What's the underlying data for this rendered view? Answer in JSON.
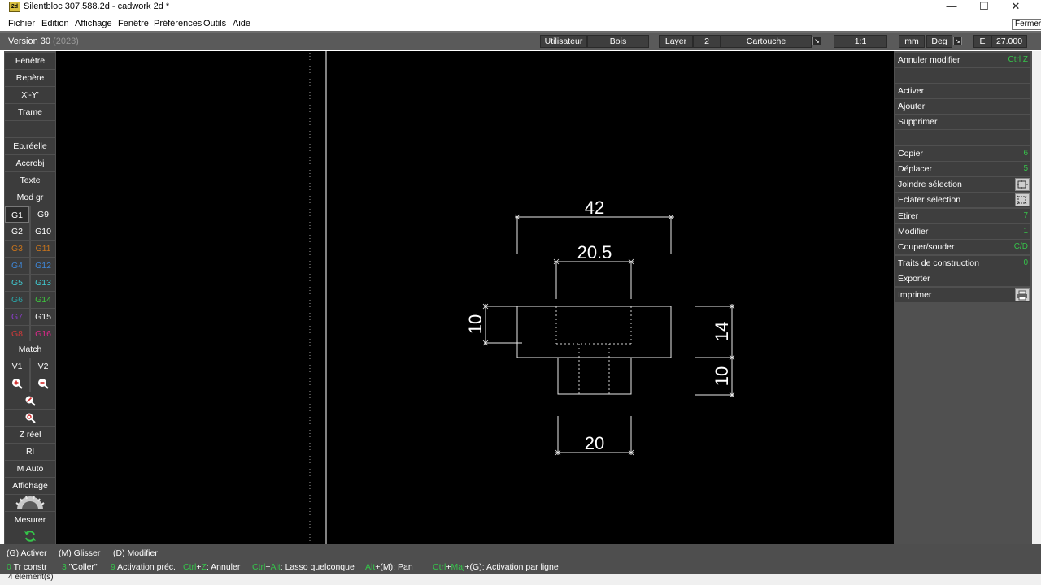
{
  "window": {
    "title": "Silentbloc 307.588.2d - cadwork 2d  *",
    "app_icon_text": "2d",
    "minimize": "—",
    "maximize": "☐",
    "close": "✕",
    "tooltip": "Fermer"
  },
  "menu": [
    "Fichier",
    "Edition",
    "Affichage",
    "Fenêtre",
    "Préférences",
    "Outils",
    "Aide"
  ],
  "topbar": {
    "version": "Version 30",
    "year": "(2023)",
    "utilisateur": "Utilisateur",
    "bois": "Bois",
    "layer_label": "Layer",
    "layer_value": "2",
    "cartouche": "Cartouche",
    "scale": "1:1",
    "unit": "mm",
    "angle_unit": "Deg",
    "e_label": "E",
    "e_value": "27.000"
  },
  "left_toolbar": {
    "fenetre": "Fenêtre",
    "repere": "Repère",
    "xy": "X'-Y'",
    "trame": "Trame",
    "ep_reelle": "Ep.réelle",
    "accrobj": "Accrobj",
    "texte": "Texte",
    "mod_gr": "Mod gr",
    "groups": [
      {
        "left": "G1",
        "right": "G9",
        "left_color": "#ffffff",
        "right_color": "#ffffff"
      },
      {
        "left": "G2",
        "right": "G10",
        "left_color": "#ffffff",
        "right_color": "#ffffff"
      },
      {
        "left": "G3",
        "right": "G11",
        "left_color": "#c8741c",
        "right_color": "#c8741c"
      },
      {
        "left": "G4",
        "right": "G12",
        "left_color": "#3f86d6",
        "right_color": "#3f86d6"
      },
      {
        "left": "G5",
        "right": "G13",
        "left_color": "#41c8cf",
        "right_color": "#41c8cf"
      },
      {
        "left": "G6",
        "right": "G14",
        "left_color": "#2aa5a8",
        "right_color": "#3ec53e"
      },
      {
        "left": "G7",
        "right": "G15",
        "left_color": "#8a3cc8",
        "right_color": "#ffffff"
      },
      {
        "left": "G8",
        "right": "G16",
        "left_color": "#d23a3a",
        "right_color": "#e0288c"
      }
    ],
    "match": "Match",
    "v1": "V1",
    "v2": "V2",
    "z_reel": "Z réel",
    "rl": "Rl",
    "m_auto": "M Auto",
    "affichage": "Affichage",
    "mesurer": "Mesurer"
  },
  "right_panel": {
    "items": [
      {
        "label": "Annuler modifier",
        "shortcut": "Ctrl Z"
      },
      {
        "label": "Activer",
        "shortcut": ""
      },
      {
        "label": "Ajouter",
        "shortcut": ""
      },
      {
        "label": "Supprimer",
        "shortcut": ""
      },
      {
        "label": "Copier",
        "shortcut": "6"
      },
      {
        "label": "Déplacer",
        "shortcut": "5"
      },
      {
        "label": "Joindre sélection",
        "shortcut": ""
      },
      {
        "label": "Eclater sélection",
        "shortcut": ""
      },
      {
        "label": "Etirer",
        "shortcut": "7"
      },
      {
        "label": "Modifier",
        "shortcut": "1"
      },
      {
        "label": "Couper/souder",
        "shortcut": "C/D"
      },
      {
        "label": "Traits de construction",
        "shortcut": "0"
      },
      {
        "label": "Exporter",
        "shortcut": ""
      },
      {
        "label": "Imprimer",
        "shortcut": ""
      }
    ]
  },
  "drawing": {
    "dim_top": "42",
    "dim_inner": "20.5",
    "dim_left": "10",
    "dim_right_top": "14",
    "dim_right_bottom": "10",
    "dim_bottom": "20"
  },
  "status": {
    "line1": {
      "g": "(G) Activer",
      "m": "(M) Glisser",
      "d": "(D) Modifier"
    },
    "line2": {
      "k0": "0",
      "t0": " Tr constr",
      "k3": "3",
      "t3": " \"Coller\"",
      "k9": "9",
      "t9": " Activation préc.",
      "ctrl1": "Ctrl",
      "plus1": "+",
      "z": "Z",
      "t_annuler": ": Annuler",
      "ctrl2": "Ctrl",
      "plus2": "+",
      "alt1": "Alt",
      "t_lasso": ": Lasso quelconque",
      "alt2": "Alt",
      "t_pan": "+(M): Pan",
      "ctrl3": "Ctrl",
      "plus3": "+",
      "maj": "Maj",
      "t_ligne": "+(G): Activation par ligne"
    },
    "elements": "4 élément(s)"
  },
  "colors": {
    "accent_green": "#35c44a",
    "canvas": "#000000",
    "panel": "#505050"
  }
}
